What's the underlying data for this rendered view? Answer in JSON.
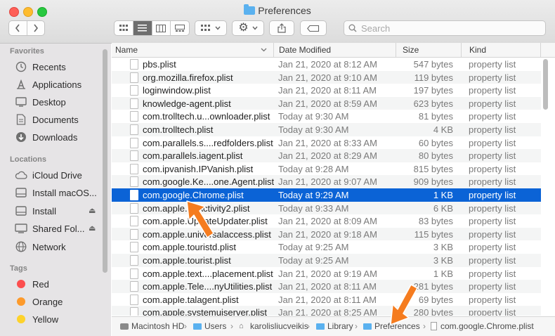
{
  "window": {
    "title": "Preferences"
  },
  "toolbar": {
    "back_icon": "chevron-left-icon",
    "forward_icon": "chevron-right-icon",
    "views": [
      "icon-view",
      "list-view",
      "column-view",
      "gallery-view"
    ],
    "active_view": "list-view",
    "group_icon": "group-grid-icon",
    "action_icon": "gear-icon",
    "share_icon": "share-icon",
    "tag_icon": "tag-icon",
    "search_placeholder": "Search"
  },
  "sidebar": {
    "favorites_label": "Favorites",
    "favorites": [
      {
        "label": "Recents",
        "icon": "clock-icon"
      },
      {
        "label": "Applications",
        "icon": "applications-icon"
      },
      {
        "label": "Desktop",
        "icon": "desktop-icon"
      },
      {
        "label": "Documents",
        "icon": "documents-icon"
      },
      {
        "label": "Downloads",
        "icon": "downloads-icon"
      }
    ],
    "locations_label": "Locations",
    "locations": [
      {
        "label": "iCloud Drive",
        "icon": "cloud-icon"
      },
      {
        "label": "Install macOS...",
        "icon": "disk-icon"
      },
      {
        "label": "Install",
        "icon": "disk-icon",
        "eject": true
      },
      {
        "label": "Shared Fol...",
        "icon": "shared-display-icon",
        "eject": true
      },
      {
        "label": "Network",
        "icon": "network-icon"
      }
    ],
    "tags_label": "Tags",
    "tags": [
      {
        "label": "Red",
        "color": "#fc4e4e"
      },
      {
        "label": "Orange",
        "color": "#fd9a2b"
      },
      {
        "label": "Yellow",
        "color": "#fdd22b"
      }
    ]
  },
  "list": {
    "columns": {
      "name": "Name",
      "date": "Date Modified",
      "size": "Size",
      "kind": "Kind"
    },
    "selected_index": 10,
    "rows": [
      {
        "name": "pbs.plist",
        "date": "Jan 21, 2020 at 8:12 AM",
        "size": "547 bytes",
        "kind": "property list"
      },
      {
        "name": "org.mozilla.firefox.plist",
        "date": "Jan 21, 2020 at 9:10 AM",
        "size": "119 bytes",
        "kind": "property list"
      },
      {
        "name": "loginwindow.plist",
        "date": "Jan 21, 2020 at 8:11 AM",
        "size": "197 bytes",
        "kind": "property list"
      },
      {
        "name": "knowledge-agent.plist",
        "date": "Jan 21, 2020 at 8:59 AM",
        "size": "623 bytes",
        "kind": "property list"
      },
      {
        "name": "com.trolltech.u...ownloader.plist",
        "date": "Today at 9:30 AM",
        "size": "81 bytes",
        "kind": "property list"
      },
      {
        "name": "com.trolltech.plist",
        "date": "Today at 9:30 AM",
        "size": "4 KB",
        "kind": "property list"
      },
      {
        "name": "com.parallels.s....redfolders.plist",
        "date": "Jan 21, 2020 at 8:33 AM",
        "size": "60 bytes",
        "kind": "property list"
      },
      {
        "name": "com.parallels.iagent.plist",
        "date": "Jan 21, 2020 at 8:29 AM",
        "size": "80 bytes",
        "kind": "property list"
      },
      {
        "name": "com.ipvanish.IPVanish.plist",
        "date": "Today at 9:28 AM",
        "size": "815 bytes",
        "kind": "property list"
      },
      {
        "name": "com.google.Ke....one.Agent.plist",
        "date": "Jan 21, 2020 at 9:07 AM",
        "size": "909 bytes",
        "kind": "property list"
      },
      {
        "name": "com.google.Chrome.plist",
        "date": "Today at 9:29 AM",
        "size": "1 KB",
        "kind": "property list"
      },
      {
        "name": "com.apple.xpActivity2.plist",
        "date": "Today at 9:33 AM",
        "size": "6 KB",
        "kind": "property list"
      },
      {
        "name": "com.apple.UpdateUpdater.plist",
        "date": "Jan 21, 2020 at 8:09 AM",
        "size": "83 bytes",
        "kind": "property list"
      },
      {
        "name": "com.apple.universalaccess.plist",
        "date": "Jan 21, 2020 at 9:18 AM",
        "size": "115 bytes",
        "kind": "property list"
      },
      {
        "name": "com.apple.touristd.plist",
        "date": "Today at 9:25 AM",
        "size": "3 KB",
        "kind": "property list"
      },
      {
        "name": "com.apple.tourist.plist",
        "date": "Today at 9:25 AM",
        "size": "3 KB",
        "kind": "property list"
      },
      {
        "name": "com.apple.text....placement.plist",
        "date": "Jan 21, 2020 at 9:19 AM",
        "size": "1 KB",
        "kind": "property list"
      },
      {
        "name": "com.apple.Tele....nyUtilities.plist",
        "date": "Jan 21, 2020 at 8:11 AM",
        "size": "281 bytes",
        "kind": "property list"
      },
      {
        "name": "com.apple.talagent.plist",
        "date": "Jan 21, 2020 at 8:11 AM",
        "size": "69 bytes",
        "kind": "property list"
      },
      {
        "name": "com.apple.systemuiserver.plist",
        "date": "Jan 21, 2020 at 8:25 AM",
        "size": "280 bytes",
        "kind": "property list"
      }
    ]
  },
  "pathbar": {
    "segments": [
      {
        "label": "Macintosh HD",
        "icon": "hard-drive-icon"
      },
      {
        "label": "Users",
        "icon": "folder-icon"
      },
      {
        "label": "karolisliucveikis",
        "icon": "home-icon"
      },
      {
        "label": "Library",
        "icon": "folder-icon"
      },
      {
        "label": "Preferences",
        "icon": "folder-icon"
      },
      {
        "label": "com.google.Chrome.plist",
        "icon": "document-icon"
      }
    ]
  },
  "annotations": {
    "arrow_color": "#f57c1f"
  }
}
